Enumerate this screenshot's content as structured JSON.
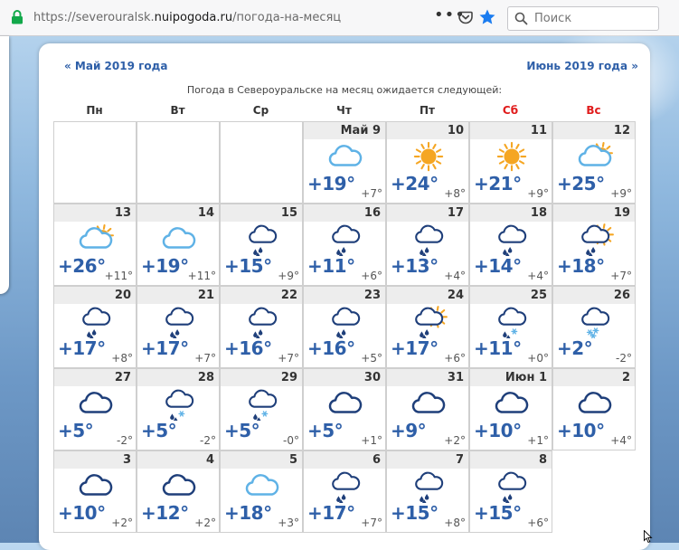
{
  "browser": {
    "url_prefix": "https://severouralsk.",
    "url_domain": "nuipogoda.ru",
    "url_path": "/погода-на-месяц",
    "search_placeholder": "Поиск"
  },
  "page": {
    "prev_month": "« Май 2019 года",
    "next_month": "Июнь 2019 года »",
    "subtitle": "Погода в Североуральске на месяц ожидается следующей:",
    "weekdays": [
      "Пн",
      "Вт",
      "Ср",
      "Чт",
      "Пт",
      "Сб",
      "Вс"
    ]
  },
  "days": [
    {
      "label": "",
      "icon": "",
      "day": "",
      "night": ""
    },
    {
      "label": "",
      "icon": "",
      "day": "",
      "night": ""
    },
    {
      "label": "",
      "icon": "",
      "day": "",
      "night": ""
    },
    {
      "label": "Май 9",
      "icon": "cloud-icon",
      "day": "+19°",
      "night": "+7°"
    },
    {
      "label": "10",
      "icon": "sun-icon",
      "day": "+24°",
      "night": "+8°"
    },
    {
      "label": "11",
      "icon": "sun-icon",
      "day": "+21°",
      "night": "+9°"
    },
    {
      "label": "12",
      "icon": "sun-cloud-icon",
      "day": "+25°",
      "night": "+9°"
    },
    {
      "label": "13",
      "icon": "sun-cloud-icon",
      "day": "+26°",
      "night": "+11°"
    },
    {
      "label": "14",
      "icon": "cloud-icon",
      "day": "+19°",
      "night": "+11°"
    },
    {
      "label": "15",
      "icon": "rain-cloud-icon",
      "day": "+15°",
      "night": "+9°"
    },
    {
      "label": "16",
      "icon": "rain-cloud-icon",
      "day": "+11°",
      "night": "+6°"
    },
    {
      "label": "17",
      "icon": "rain-cloud-icon",
      "day": "+13°",
      "night": "+4°"
    },
    {
      "label": "18",
      "icon": "rain-cloud-icon",
      "day": "+14°",
      "night": "+4°"
    },
    {
      "label": "19",
      "icon": "sun-rain-cloud-icon",
      "day": "+18°",
      "night": "+7°"
    },
    {
      "label": "20",
      "icon": "rain-cloud-icon",
      "day": "+17°",
      "night": "+8°"
    },
    {
      "label": "21",
      "icon": "rain-cloud-icon",
      "day": "+17°",
      "night": "+7°"
    },
    {
      "label": "22",
      "icon": "rain-cloud-icon",
      "day": "+16°",
      "night": "+7°"
    },
    {
      "label": "23",
      "icon": "rain-cloud-icon",
      "day": "+16°",
      "night": "+5°"
    },
    {
      "label": "24",
      "icon": "sun-rain-cloud-icon",
      "day": "+17°",
      "night": "+6°"
    },
    {
      "label": "25",
      "icon": "sleet-cloud-icon",
      "day": "+11°",
      "night": "+0°"
    },
    {
      "label": "26",
      "icon": "snow-cloud-icon",
      "day": "+2°",
      "night": "-2°"
    },
    {
      "label": "27",
      "icon": "dark-cloud-icon",
      "day": "+5°",
      "night": "-2°"
    },
    {
      "label": "28",
      "icon": "sleet-cloud-icon",
      "day": "+5°",
      "night": "-2°"
    },
    {
      "label": "29",
      "icon": "sleet-cloud-icon",
      "day": "+5°",
      "night": "-0°"
    },
    {
      "label": "30",
      "icon": "dark-cloud-icon",
      "day": "+5°",
      "night": "+1°"
    },
    {
      "label": "31",
      "icon": "dark-cloud-icon",
      "day": "+9°",
      "night": "+2°"
    },
    {
      "label": "Июн 1",
      "icon": "dark-cloud-icon",
      "day": "+10°",
      "night": "+1°"
    },
    {
      "label": "2",
      "icon": "dark-cloud-icon",
      "day": "+10°",
      "night": "+4°"
    },
    {
      "label": "3",
      "icon": "dark-cloud-icon",
      "day": "+10°",
      "night": "+2°"
    },
    {
      "label": "4",
      "icon": "dark-cloud-icon",
      "day": "+12°",
      "night": "+2°"
    },
    {
      "label": "5",
      "icon": "cloud-icon",
      "day": "+18°",
      "night": "+3°"
    },
    {
      "label": "6",
      "icon": "rain-cloud-icon",
      "day": "+17°",
      "night": "+7°"
    },
    {
      "label": "7",
      "icon": "rain-cloud-icon",
      "day": "+15°",
      "night": "+8°"
    },
    {
      "label": "8",
      "icon": "rain-cloud-icon",
      "day": "+15°",
      "night": "+6°"
    }
  ],
  "colors": {
    "accent_blue": "#2e5fa8",
    "weekend_red": "#e01b1b",
    "sun_orange": "#f5a623",
    "light_cloud": "#5fb2e6",
    "dark_cloud": "#1f3f7a"
  }
}
